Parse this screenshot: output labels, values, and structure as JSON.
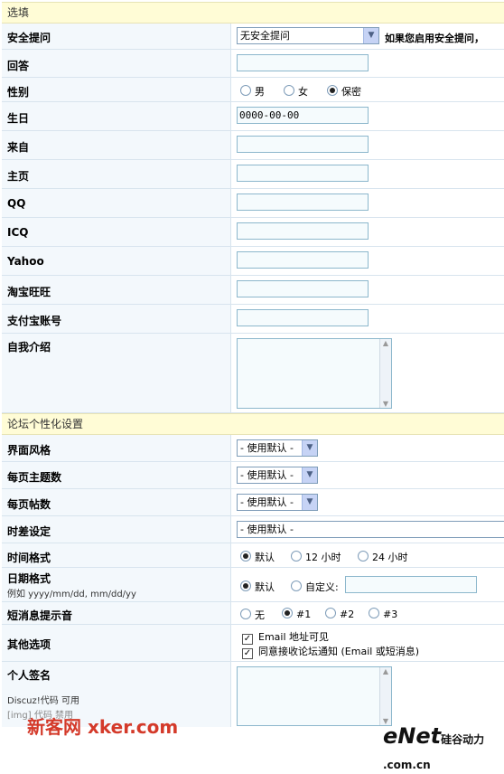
{
  "sections": {
    "optional": "选填",
    "forum_personal": "论坛个性化设置"
  },
  "security": {
    "label": "安全提问",
    "select_value": "无安全提问",
    "note": "如果您启用安全提问，"
  },
  "answer": {
    "label": "回答",
    "value": ""
  },
  "gender": {
    "label": "性别",
    "options": [
      "男",
      "女",
      "保密"
    ],
    "selected": "保密"
  },
  "birthday": {
    "label": "生日",
    "value": "0000-00-00"
  },
  "from": {
    "label": "来自",
    "value": ""
  },
  "homepage": {
    "label": "主页",
    "value": ""
  },
  "qq": {
    "label": "QQ",
    "value": ""
  },
  "icq": {
    "label": "ICQ",
    "value": ""
  },
  "yahoo": {
    "label": "Yahoo",
    "value": ""
  },
  "taobao": {
    "label": "淘宝旺旺",
    "value": ""
  },
  "alipay": {
    "label": "支付宝账号",
    "value": ""
  },
  "intro": {
    "label": "自我介绍",
    "value": ""
  },
  "style": {
    "label": "界面风格",
    "value": "- 使用默认 -"
  },
  "topics_per_page": {
    "label": "每页主题数",
    "value": "- 使用默认 -"
  },
  "posts_per_page": {
    "label": "每页帖数",
    "value": "- 使用默认 -"
  },
  "timezone": {
    "label": "时差设定",
    "value": "- 使用默认 -"
  },
  "time_format": {
    "label": "时间格式",
    "options": [
      "默认",
      "12 小时",
      "24 小时"
    ],
    "selected": "默认"
  },
  "date_format": {
    "label": "日期格式",
    "hint": "例如 yyyy/mm/dd, mm/dd/yy",
    "options": [
      "默认",
      "自定义:"
    ],
    "selected": "默认",
    "custom_value": ""
  },
  "pm_sound": {
    "label": "短消息提示音",
    "options": [
      "无",
      "#1",
      "#2",
      "#3"
    ],
    "selected": "#1"
  },
  "other": {
    "label": "其他选项",
    "options": [
      "Email 地址可见",
      "同意接收论坛通知 (Email 或短消息)"
    ],
    "checked": [
      true,
      true
    ]
  },
  "signature": {
    "label": "个人签名",
    "discuz_note": "Discuz!代码 可用",
    "img_note": "[img] 代码 禁用",
    "value": ""
  },
  "watermarks": {
    "left": "新客网 xker.com",
    "right": "eNet",
    "right_small": "硅谷动力 .com.cn"
  }
}
